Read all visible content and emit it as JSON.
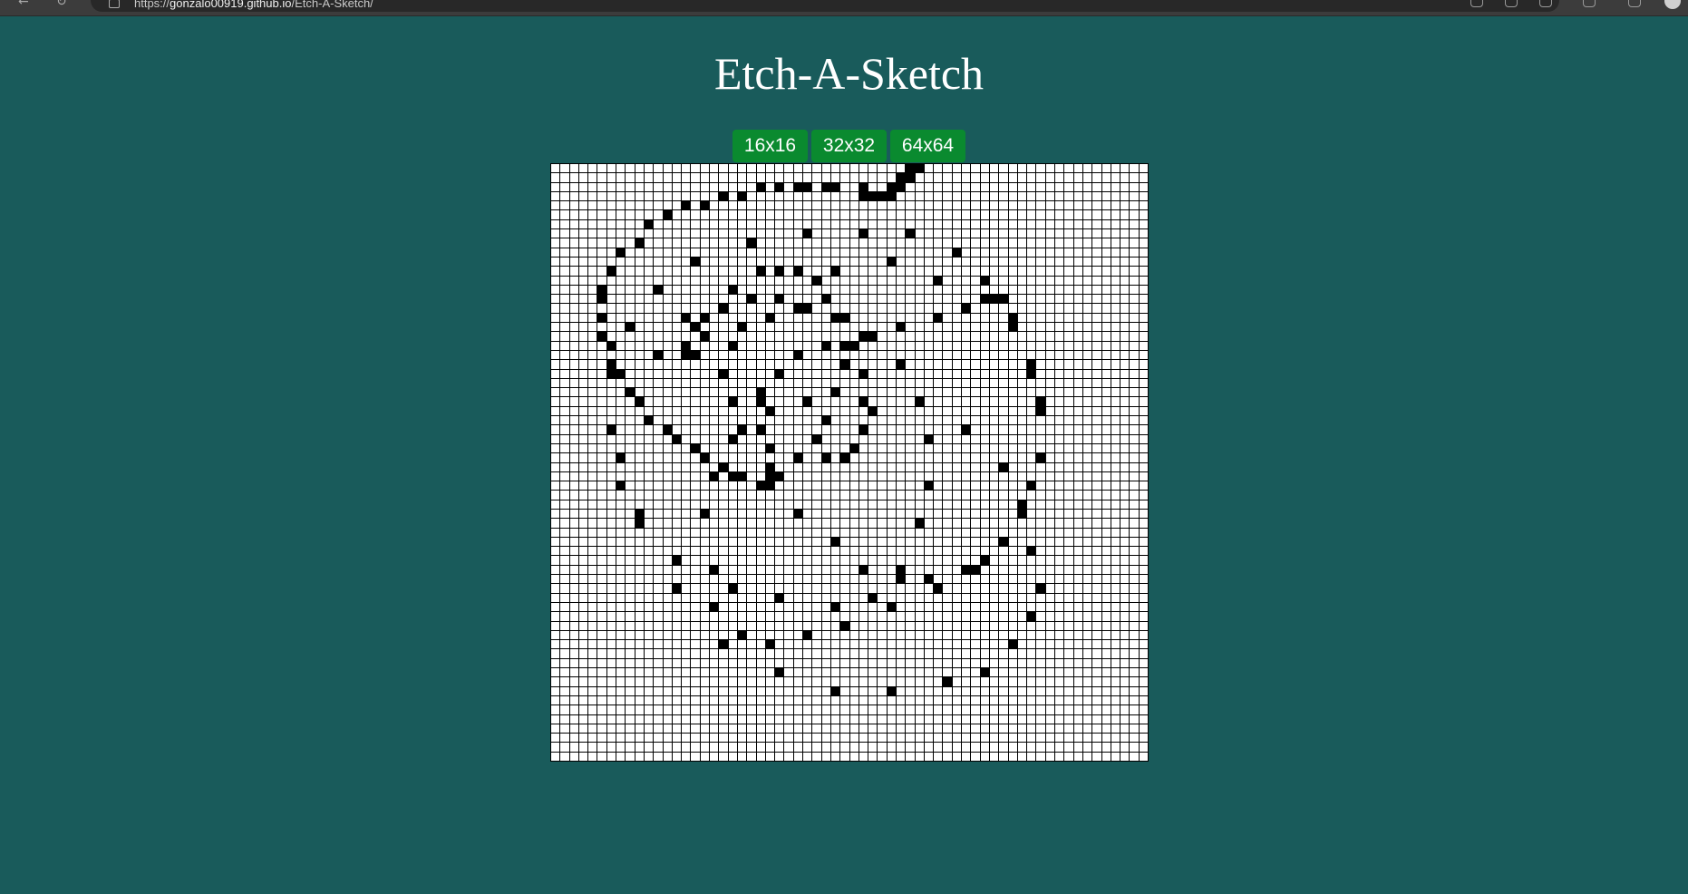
{
  "browser": {
    "url_scheme": "https://",
    "url_host": "gonzalo00919.github.io",
    "url_path": "/Etch-A-Sketch/"
  },
  "page": {
    "title": "Etch-A-Sketch"
  },
  "controls": {
    "buttons": [
      {
        "label": "16x16"
      },
      {
        "label": "32x32"
      },
      {
        "label": "64x64"
      }
    ]
  },
  "sketch": {
    "grid_size": 64,
    "filled_cells": [
      [
        0,
        38
      ],
      [
        0,
        39
      ],
      [
        1,
        37
      ],
      [
        1,
        38
      ],
      [
        2,
        22
      ],
      [
        2,
        24
      ],
      [
        2,
        26
      ],
      [
        2,
        27
      ],
      [
        2,
        29
      ],
      [
        2,
        30
      ],
      [
        2,
        33
      ],
      [
        2,
        36
      ],
      [
        2,
        37
      ],
      [
        3,
        18
      ],
      [
        3,
        20
      ],
      [
        3,
        33
      ],
      [
        3,
        34
      ],
      [
        3,
        35
      ],
      [
        3,
        36
      ],
      [
        4,
        14
      ],
      [
        4,
        16
      ],
      [
        5,
        12
      ],
      [
        6,
        10
      ],
      [
        7,
        27
      ],
      [
        7,
        33
      ],
      [
        7,
        38
      ],
      [
        8,
        9
      ],
      [
        8,
        21
      ],
      [
        9,
        7
      ],
      [
        9,
        43
      ],
      [
        10,
        15
      ],
      [
        10,
        36
      ],
      [
        11,
        6
      ],
      [
        11,
        22
      ],
      [
        11,
        24
      ],
      [
        11,
        26
      ],
      [
        11,
        30
      ],
      [
        12,
        28
      ],
      [
        12,
        41
      ],
      [
        12,
        46
      ],
      [
        13,
        5
      ],
      [
        13,
        11
      ],
      [
        13,
        19
      ],
      [
        14,
        5
      ],
      [
        14,
        21
      ],
      [
        14,
        24
      ],
      [
        14,
        29
      ],
      [
        14,
        46
      ],
      [
        14,
        47
      ],
      [
        14,
        48
      ],
      [
        15,
        18
      ],
      [
        15,
        26
      ],
      [
        15,
        27
      ],
      [
        15,
        44
      ],
      [
        16,
        5
      ],
      [
        16,
        14
      ],
      [
        16,
        16
      ],
      [
        16,
        23
      ],
      [
        16,
        30
      ],
      [
        16,
        31
      ],
      [
        16,
        41
      ],
      [
        16,
        49
      ],
      [
        17,
        8
      ],
      [
        17,
        15
      ],
      [
        17,
        20
      ],
      [
        17,
        37
      ],
      [
        17,
        49
      ],
      [
        18,
        5
      ],
      [
        18,
        16
      ],
      [
        18,
        33
      ],
      [
        18,
        34
      ],
      [
        19,
        6
      ],
      [
        19,
        14
      ],
      [
        19,
        19
      ],
      [
        19,
        29
      ],
      [
        19,
        31
      ],
      [
        19,
        32
      ],
      [
        20,
        11
      ],
      [
        20,
        14
      ],
      [
        20,
        15
      ],
      [
        20,
        26
      ],
      [
        21,
        6
      ],
      [
        21,
        31
      ],
      [
        21,
        37
      ],
      [
        21,
        51
      ],
      [
        22,
        6
      ],
      [
        22,
        7
      ],
      [
        22,
        18
      ],
      [
        22,
        24
      ],
      [
        22,
        33
      ],
      [
        22,
        51
      ],
      [
        24,
        8
      ],
      [
        24,
        22
      ],
      [
        24,
        30
      ],
      [
        25,
        9
      ],
      [
        25,
        19
      ],
      [
        25,
        22
      ],
      [
        25,
        27
      ],
      [
        25,
        33
      ],
      [
        25,
        39
      ],
      [
        25,
        52
      ],
      [
        26,
        23
      ],
      [
        26,
        34
      ],
      [
        26,
        52
      ],
      [
        27,
        10
      ],
      [
        27,
        29
      ],
      [
        28,
        6
      ],
      [
        28,
        12
      ],
      [
        28,
        20
      ],
      [
        28,
        22
      ],
      [
        28,
        33
      ],
      [
        28,
        44
      ],
      [
        29,
        13
      ],
      [
        29,
        19
      ],
      [
        29,
        28
      ],
      [
        29,
        40
      ],
      [
        30,
        15
      ],
      [
        30,
        23
      ],
      [
        30,
        32
      ],
      [
        31,
        7
      ],
      [
        31,
        16
      ],
      [
        31,
        26
      ],
      [
        31,
        29
      ],
      [
        31,
        31
      ],
      [
        31,
        52
      ],
      [
        32,
        18
      ],
      [
        32,
        23
      ],
      [
        32,
        48
      ],
      [
        33,
        17
      ],
      [
        33,
        19
      ],
      [
        33,
        20
      ],
      [
        33,
        23
      ],
      [
        33,
        24
      ],
      [
        34,
        7
      ],
      [
        34,
        22
      ],
      [
        34,
        23
      ],
      [
        34,
        40
      ],
      [
        34,
        51
      ],
      [
        36,
        50
      ],
      [
        37,
        9
      ],
      [
        37,
        16
      ],
      [
        37,
        26
      ],
      [
        37,
        50
      ],
      [
        38,
        9
      ],
      [
        38,
        39
      ],
      [
        40,
        30
      ],
      [
        40,
        48
      ],
      [
        41,
        51
      ],
      [
        42,
        13
      ],
      [
        42,
        46
      ],
      [
        43,
        17
      ],
      [
        43,
        33
      ],
      [
        43,
        37
      ],
      [
        43,
        44
      ],
      [
        43,
        45
      ],
      [
        44,
        37
      ],
      [
        44,
        40
      ],
      [
        45,
        13
      ],
      [
        45,
        19
      ],
      [
        45,
        41
      ],
      [
        45,
        52
      ],
      [
        46,
        24
      ],
      [
        46,
        34
      ],
      [
        47,
        17
      ],
      [
        47,
        30
      ],
      [
        47,
        36
      ],
      [
        48,
        51
      ],
      [
        49,
        31
      ],
      [
        50,
        20
      ],
      [
        50,
        27
      ],
      [
        51,
        18
      ],
      [
        51,
        23
      ],
      [
        51,
        49
      ],
      [
        54,
        24
      ],
      [
        54,
        46
      ],
      [
        55,
        42
      ],
      [
        56,
        30
      ],
      [
        56,
        36
      ]
    ]
  }
}
